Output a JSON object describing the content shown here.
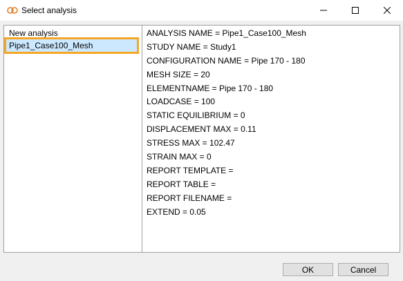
{
  "window": {
    "title": "Select analysis"
  },
  "analyses": {
    "items": [
      {
        "label": "New analysis"
      },
      {
        "label": "Pipe1_Case100_Mesh",
        "selected": true
      }
    ]
  },
  "details": {
    "lines": [
      "ANALYSIS NAME = Pipe1_Case100_Mesh",
      "STUDY NAME = Study1",
      "CONFIGURATION NAME = Pipe 170 - 180",
      "MESH SIZE = 20",
      "ELEMENTNAME = Pipe 170 - 180",
      "LOADCASE = 100",
      "STATIC EQUILIBRIUM = 0",
      "DISPLACEMENT MAX = 0.11",
      "STRESS MAX = 102.47",
      "STRAIN MAX = 0",
      "REPORT TEMPLATE =",
      "REPORT TABLE =",
      "REPORT FILENAME =",
      "EXTEND = 0.05"
    ]
  },
  "buttons": {
    "ok": "OK",
    "cancel": "Cancel"
  },
  "colors": {
    "selection": "#cce8ff",
    "highlight_border": "#f5a623",
    "app_icon": "#e07b20"
  }
}
